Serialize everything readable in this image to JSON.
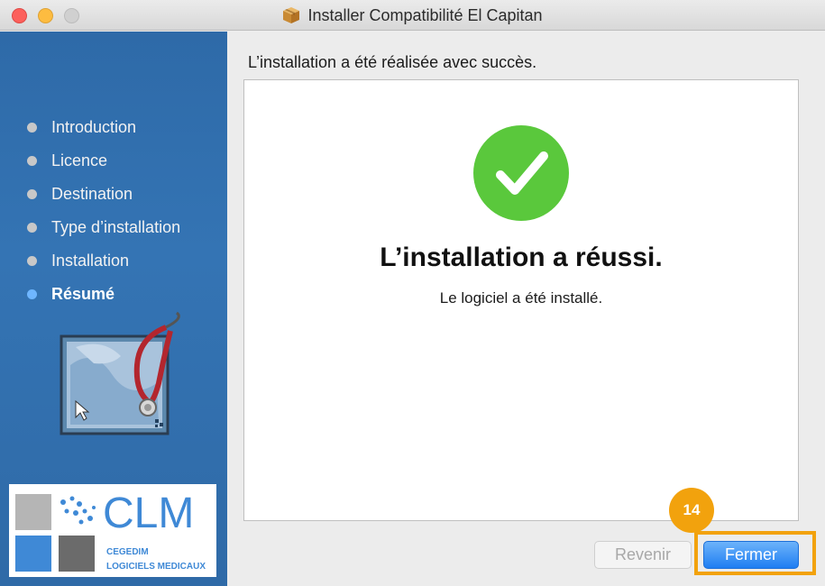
{
  "window": {
    "title": "Installer Compatibilité El Capitan",
    "title_icon": "package-icon"
  },
  "sidebar": {
    "steps": [
      {
        "label": "Introduction",
        "active": false
      },
      {
        "label": "Licence",
        "active": false
      },
      {
        "label": "Destination",
        "active": false
      },
      {
        "label": "Type d’installation",
        "active": false
      },
      {
        "label": "Installation",
        "active": false
      },
      {
        "label": "Résumé",
        "active": true
      }
    ],
    "illustration": "stethoscope-illustration",
    "logo": {
      "brand": "CLM",
      "line1": "CEGEDIM",
      "line2": "LOGICIELS MEDICAUX"
    }
  },
  "content": {
    "header": "L’installation a été réalisée avec succès.",
    "success_title": "L’installation a réussi.",
    "success_subtitle": "Le logiciel a été installé.",
    "check_icon": "checkmark-icon"
  },
  "buttons": {
    "back": "Revenir",
    "close": "Fermer"
  },
  "annotation": {
    "step_number": "14",
    "color": "#f2a20d"
  },
  "colors": {
    "sidebar": "#3474b4",
    "success_green": "#5ac83c",
    "primary_button": "#1f7ef2"
  }
}
